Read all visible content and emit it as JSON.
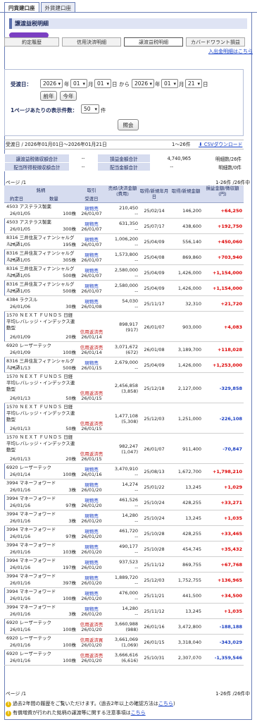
{
  "tabs": [
    "円貨建口座",
    "外貨建口座"
  ],
  "page_title": "譲渡益税明細",
  "categories": [
    "約定履歴",
    "信用決済明細",
    "譲渡益税明細",
    "カバードワラント損益"
  ],
  "help_link": "入出金明細はこちら",
  "search": {
    "label_date": "受渡日：",
    "year_from": "2026",
    "month_from": "01",
    "day_from": "01",
    "year_to": "2026",
    "month_to": "01",
    "day_to": "21",
    "year_unit": "年",
    "month_unit": "月",
    "day_unit": "日",
    "from_word": "から",
    "btn_prev_year": "前年",
    "btn_this_year": "今年",
    "per_page_label": "1ページあたりの表示件数：",
    "per_page": "50",
    "per_page_unit": "件",
    "btn_search": "照会"
  },
  "period": {
    "text": "受渡日 / 2026年01月01日〜2026年01月21日",
    "count": "1〜26件",
    "csv": "CSVダウンロード"
  },
  "summary": [
    {
      "h1": "譲渡益税徴収額合計",
      "v1": "--",
      "h2": "損益金額合計",
      "v2": "4,740,965",
      "h3": "明細数/26件"
    },
    {
      "h1": "配当所得税徴収額合計",
      "v1": "--",
      "h2": "配当金額合計",
      "v2": "--",
      "h3": "明細数/0件"
    }
  ],
  "pager_left": "ページ /1",
  "pager_right": "1-26件 /26件中",
  "header": {
    "c1": "銘柄",
    "c1b": "約定日",
    "c1c": "数量",
    "c2": "取引",
    "c2b": "受渡日",
    "c3": "売却/決済金額(費用)",
    "c4": "取得/新規年月日",
    "c5": "取得/新規金額",
    "c6": "損益金額/徴収額(円)"
  },
  "rows": [
    {
      "name": "4503 アステラス製薬",
      "date": "26/01/05",
      "qty": "100株",
      "type": "現物売",
      "deliv": "26/01/07",
      "amt": "210,450",
      "fee": "--",
      "acq_date": "25/02/14",
      "acq": "146,200",
      "pl": "+64,250",
      "s": 1
    },
    {
      "name": "4503 アステラス製薬",
      "date": "26/01/05",
      "qty": "300株",
      "type": "現物売",
      "deliv": "26/01/07",
      "amt": "631,350",
      "fee": "--",
      "acq_date": "25/07/17",
      "acq": "438,600",
      "pl": "+192,750",
      "s": 1
    },
    {
      "name": "8316 三井住友フィナンシャルグループ",
      "date": "26/01/05",
      "qty": "195株",
      "type": "現物売",
      "deliv": "26/01/07",
      "amt": "1,006,200",
      "fee": "--",
      "acq_date": "25/04/09",
      "acq": "556,140",
      "pl": "+450,060",
      "s": 1
    },
    {
      "name": "8316 三井住友フィナンシャルグループ",
      "date": "26/01/05",
      "qty": "305株",
      "type": "現物売",
      "deliv": "26/01/07",
      "amt": "1,573,800",
      "fee": "--",
      "acq_date": "25/04/08",
      "acq": "869,860",
      "pl": "+703,940",
      "s": 1
    },
    {
      "name": "8316 三井住友フィナンシャルグループ",
      "date": "26/01/05",
      "qty": "500株",
      "type": "現物売",
      "deliv": "26/01/07",
      "amt": "2,580,000",
      "fee": "--",
      "acq_date": "25/04/09",
      "acq": "1,426,000",
      "pl": "+1,154,000",
      "s": 1
    },
    {
      "name": "8316 三井住友フィナンシャルグループ",
      "date": "26/01/05",
      "qty": "500株",
      "type": "現物売",
      "deliv": "26/01/07",
      "amt": "2,580,000",
      "fee": "--",
      "acq_date": "25/04/09",
      "acq": "1,426,000",
      "pl": "+1,154,000",
      "s": 1
    },
    {
      "name": "4384 ラクスル",
      "date": "26/01/06",
      "qty": "30株",
      "type": "現物売",
      "deliv": "26/01/08",
      "amt": "54,030",
      "fee": "--",
      "acq_date": "25/11/17",
      "acq": "32,310",
      "pl": "+21,720",
      "s": 1
    },
    {
      "name": "1570 ＮＥＸＴ ＦＵＮＤＳ 日経平均レバレッジ・インデックス連動型",
      "date": "26/01/09",
      "qty": "20株",
      "type": "信用返済売",
      "deliv": "26/01/14",
      "amt": "898,917",
      "fee": "(917)",
      "acq_date": "26/01/07",
      "acq": "903,000",
      "pl": "+4,083",
      "s": 1
    },
    {
      "name": "6920 レーザーテック",
      "date": "26/01/09",
      "qty": "100株",
      "type": "信用返済売",
      "deliv": "26/01/14",
      "amt": "3,071,672",
      "fee": "(672)",
      "acq_date": "26/01/08",
      "acq": "3,189,700",
      "pl": "+118,028",
      "s": 1
    },
    {
      "name": "8316 三井住友フィナンシャルグループ",
      "date": "26/01/13",
      "qty": "500株",
      "type": "現物売",
      "deliv": "26/01/15",
      "amt": "2,679,000",
      "fee": "--",
      "acq_date": "25/04/09",
      "acq": "1,426,000",
      "pl": "+1,253,000",
      "s": 1
    },
    {
      "name": "1570 ＮＥＸＴ ＦＵＮＤＳ 日経平均レバレッジ・インデックス連動型",
      "date": "26/01/13",
      "qty": "50株",
      "type": "信用返済売",
      "deliv": "26/01/15",
      "amt": "2,456,858",
      "fee": "(3,858)",
      "acq_date": "25/12/18",
      "acq": "2,127,000",
      "pl": "-329,858",
      "s": 0
    },
    {
      "name": "1570 ＮＥＸＴ ＦＵＮＤＳ 日経平均レバレッジ・インデックス連動型",
      "date": "26/01/13",
      "qty": "50株",
      "type": "信用返済売",
      "deliv": "26/01/15",
      "amt": "1,477,108",
      "fee": "(5,308)",
      "acq_date": "25/12/03",
      "acq": "1,251,000",
      "pl": "-226,108",
      "s": 0
    },
    {
      "name": "1570 ＮＥＸＴ ＦＵＮＤＳ 日経平均レバレッジ・インデックス連動型",
      "date": "26/01/13",
      "qty": "20株",
      "type": "信用返済売",
      "deliv": "26/01/15",
      "amt": "982,247",
      "fee": "(1,047)",
      "acq_date": "26/01/07",
      "acq": "911,400",
      "pl": "-70,847",
      "s": 0
    },
    {
      "name": "6920 レーザーテック",
      "date": "26/01/14",
      "qty": "100株",
      "type": "現物売",
      "deliv": "26/01/16",
      "amt": "3,470,910",
      "fee": "--",
      "acq_date": "25/08/13",
      "acq": "1,672,700",
      "pl": "+1,798,210",
      "s": 1
    },
    {
      "name": "3994 マネーフォワード",
      "date": "26/01/16",
      "qty": "3株",
      "type": "現物売",
      "deliv": "26/01/20",
      "amt": "14,274",
      "fee": "--",
      "acq_date": "25/01/22",
      "acq": "13,245",
      "pl": "+1,029",
      "s": 1
    },
    {
      "name": "3994 マネーフォワード",
      "date": "26/01/16",
      "qty": "97株",
      "type": "現物売",
      "deliv": "26/01/20",
      "amt": "461,526",
      "fee": "--",
      "acq_date": "25/10/24",
      "acq": "428,255",
      "pl": "+33,271",
      "s": 1
    },
    {
      "name": "3994 マネーフォワード",
      "date": "26/01/16",
      "qty": "3株",
      "type": "現物売",
      "deliv": "26/01/20",
      "amt": "14,280",
      "fee": "--",
      "acq_date": "25/10/24",
      "acq": "13,245",
      "pl": "+1,035",
      "s": 1
    },
    {
      "name": "3994 マネーフォワード",
      "date": "26/01/16",
      "qty": "97株",
      "type": "現物売",
      "deliv": "26/01/20",
      "amt": "461,720",
      "fee": "--",
      "acq_date": "25/10/28",
      "acq": "428,255",
      "pl": "+33,465",
      "s": 1
    },
    {
      "name": "3994 マネーフォワード",
      "date": "26/01/16",
      "qty": "103株",
      "type": "現物売",
      "deliv": "26/01/20",
      "amt": "490,177",
      "fee": "--",
      "acq_date": "25/10/28",
      "acq": "454,745",
      "pl": "+35,432",
      "s": 1
    },
    {
      "name": "3994 マネーフォワード",
      "date": "26/01/16",
      "qty": "197株",
      "type": "現物売",
      "deliv": "26/01/20",
      "amt": "937,523",
      "fee": "--",
      "acq_date": "25/11/12",
      "acq": "869,755",
      "pl": "+67,768",
      "s": 1
    },
    {
      "name": "3994 マネーフォワード",
      "date": "26/01/16",
      "qty": "397株",
      "type": "現物売",
      "deliv": "26/01/20",
      "amt": "1,889,720",
      "fee": "--",
      "acq_date": "25/12/03",
      "acq": "1,752,755",
      "pl": "+136,965",
      "s": 1
    },
    {
      "name": "3994 マネーフォワード",
      "date": "26/01/16",
      "qty": "100株",
      "type": "現物売",
      "deliv": "26/01/20",
      "amt": "476,000",
      "fee": "--",
      "acq_date": "25/11/21",
      "acq": "441,500",
      "pl": "+34,500",
      "s": 1
    },
    {
      "name": "3994 マネーフォワード",
      "date": "26/01/16",
      "qty": "3株",
      "type": "現物売",
      "deliv": "26/01/20",
      "amt": "14,280",
      "fee": "--",
      "acq_date": "25/11/12",
      "acq": "13,245",
      "pl": "+1,035",
      "s": 1
    },
    {
      "name": "6920 レーザーテック",
      "date": "26/01/16",
      "qty": "100株",
      "type": "信用返済売",
      "deliv": "26/01/20",
      "amt": "3,660,988",
      "fee": "(988)",
      "acq_date": "26/01/16",
      "acq": "3,472,800",
      "pl": "-188,188",
      "s": 0
    },
    {
      "name": "6920 レーザーテック",
      "date": "26/01/16",
      "qty": "100株",
      "type": "信用返済買",
      "deliv": "26/01/20",
      "amt": "3,661,069",
      "fee": "(1,069)",
      "acq_date": "26/01/15",
      "acq": "3,318,040",
      "pl": "-343,029",
      "s": 0
    },
    {
      "name": "6920 レーザーテック",
      "date": "26/01/16",
      "qty": "100株",
      "type": "信用返済売",
      "deliv": "26/01/20",
      "amt": "3,666,616",
      "fee": "(6,616)",
      "acq_date": "25/10/31",
      "acq": "2,307,070",
      "pl": "-1,359,546",
      "s": 0
    }
  ],
  "notes": [
    {
      "pre": "過去2年間の履歴をご覧いただけます。(過去2年以上の確認方法は",
      "link": "こちら",
      "post": ")"
    },
    {
      "pre": "有償増資が行われた銘柄の譲渡等に関する注意事項は",
      "link": "こちら",
      "post": ""
    }
  ]
}
